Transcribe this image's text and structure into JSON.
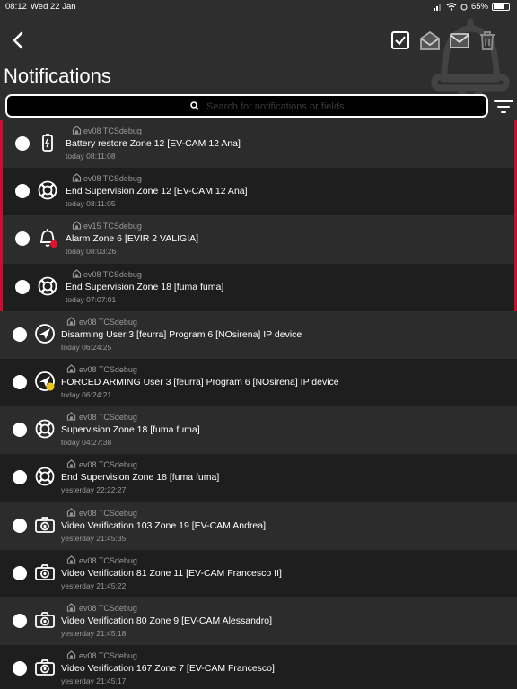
{
  "statusbar": {
    "time": "08:12",
    "date": "Wed 22 Jan",
    "battery": "65%"
  },
  "header": {
    "title": "Notifications",
    "search_placeholder": "Search for notifications or fields...",
    "icons": [
      "back-icon",
      "select-all-icon",
      "mark-read-icon",
      "mark-unread-icon",
      "delete-icon",
      "filter-icon"
    ],
    "accent_color": "#c8102e"
  },
  "notifications": [
    {
      "icon": "battery",
      "source": "ev08 TCSdebug",
      "message": "Battery restore Zone 12 [EV-CAM 12 Ana]",
      "time": "today 08:11:08",
      "unread": true
    },
    {
      "icon": "lifebuoy",
      "source": "ev08 TCSdebug",
      "message": "End Supervision Zone 12 [EV-CAM 12 Ana]",
      "time": "today 08:11:05",
      "unread": true
    },
    {
      "icon": "bell-alarm",
      "source": "ev15 TCSdebug",
      "message": "Alarm Zone 6 [EVIR 2 VALIGIA]",
      "time": "today 08:03:26",
      "unread": true
    },
    {
      "icon": "lifebuoy",
      "source": "ev08 TCSdebug",
      "message": "End Supervision Zone 18 [fuma fuma]",
      "time": "today 07:07:01",
      "unread": true
    },
    {
      "icon": "disarm",
      "source": "ev08 TCSdebug",
      "message": "Disarming User 3 [feurra] Program 6 [NOsirena] IP device",
      "time": "today 06:24:25",
      "unread": false
    },
    {
      "icon": "forced-arm",
      "source": "ev08 TCSdebug",
      "message": "FORCED ARMING User 3 [feurra] Program 6 [NOsirena] IP device",
      "time": "today 06:24:21",
      "unread": false
    },
    {
      "icon": "lifebuoy",
      "source": "ev08 TCSdebug",
      "message": "Supervision Zone 18 [fuma fuma]",
      "time": "today 04:27:38",
      "unread": false
    },
    {
      "icon": "lifebuoy",
      "source": "ev08 TCSdebug",
      "message": "End Supervision Zone 18 [fuma fuma]",
      "time": "yesterday 22:22:27",
      "unread": false
    },
    {
      "icon": "camera",
      "source": "ev08 TCSdebug",
      "message": "Video Verification 103 Zone 19 [EV-CAM Andrea]",
      "time": "yesterday 21:45:35",
      "unread": false
    },
    {
      "icon": "camera",
      "source": "ev08 TCSdebug",
      "message": "Video Verification 81 Zone 11 [EV-CAM Francesco II]",
      "time": "yesterday 21:45:22",
      "unread": false
    },
    {
      "icon": "camera",
      "source": "ev08 TCSdebug",
      "message": "Video Verification 80 Zone 9 [EV-CAM Alessandro]",
      "time": "yesterday 21:45:18",
      "unread": false
    },
    {
      "icon": "camera",
      "source": "ev08 TCSdebug",
      "message": "Video Verification 167 Zone 7 [EV-CAM Francesco]",
      "time": "yesterday 21:45:17",
      "unread": false
    }
  ]
}
